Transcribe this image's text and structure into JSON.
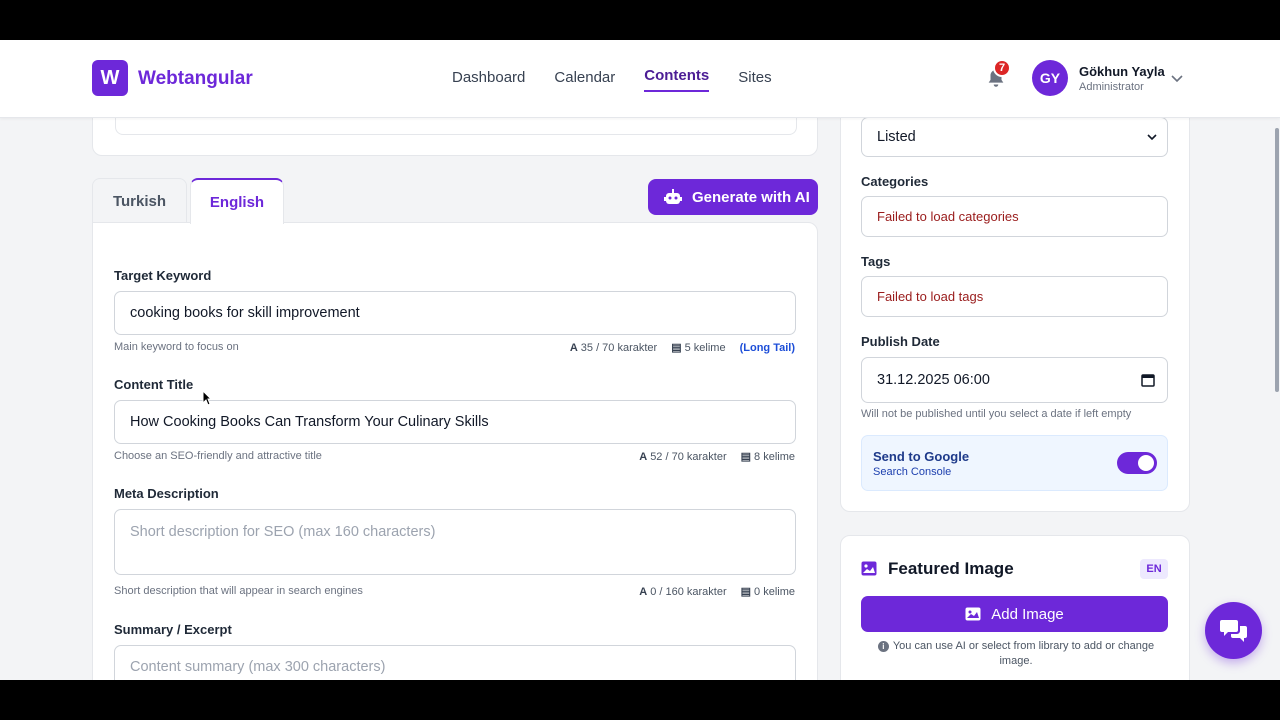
{
  "header": {
    "logo_letter": "W",
    "brand": "Webtangular",
    "nav": [
      {
        "label": "Dashboard"
      },
      {
        "label": "Calendar"
      },
      {
        "label": "Contents",
        "active": true
      },
      {
        "label": "Sites"
      }
    ],
    "notification_count": "7",
    "user": {
      "initials": "GY",
      "name": "Gökhun Yayla",
      "role": "Administrator"
    }
  },
  "tabs": {
    "turkish": "Turkish",
    "english": "English",
    "active": "English"
  },
  "generate_button": "Generate with AI",
  "form": {
    "target_keyword": {
      "label": "Target Keyword",
      "value": "cooking books for skill improvement",
      "hint": "Main keyword to focus on",
      "chars": "35 / 70 karakter",
      "words": "5 kelime",
      "tag": "(Long Tail)"
    },
    "content_title": {
      "label": "Content Title",
      "value": "How Cooking Books Can Transform Your Culinary Skills",
      "hint": "Choose an SEO-friendly and attractive title",
      "chars": "52 / 70 karakter",
      "words": "8 kelime"
    },
    "meta_description": {
      "label": "Meta Description",
      "placeholder": "Short description for SEO (max 160 characters)",
      "hint": "Short description that will appear in search engines",
      "chars": "0 / 160 karakter",
      "words": "0 kelime"
    },
    "summary": {
      "label": "Summary / Excerpt",
      "placeholder": "Content summary (max 300 characters)"
    }
  },
  "sidebar": {
    "status_value": "Listed",
    "categories": {
      "label": "Categories",
      "error": "Failed to load categories"
    },
    "tags": {
      "label": "Tags",
      "error": "Failed to load tags"
    },
    "publish_date": {
      "label": "Publish Date",
      "value": "31.12.2025 06:00",
      "hint": "Will not be published until you select a date if left empty"
    },
    "google": {
      "title": "Send to Google",
      "subtitle": "Search Console",
      "enabled": true
    },
    "featured_image": {
      "title": "Featured Image",
      "lang_badge": "EN",
      "add_button": "Add Image",
      "hint": "You can use AI or select from library to add or change image."
    }
  },
  "colors": {
    "accent": "#6d28d9",
    "error_text": "#991b1b",
    "info_bg": "#eff6ff"
  }
}
